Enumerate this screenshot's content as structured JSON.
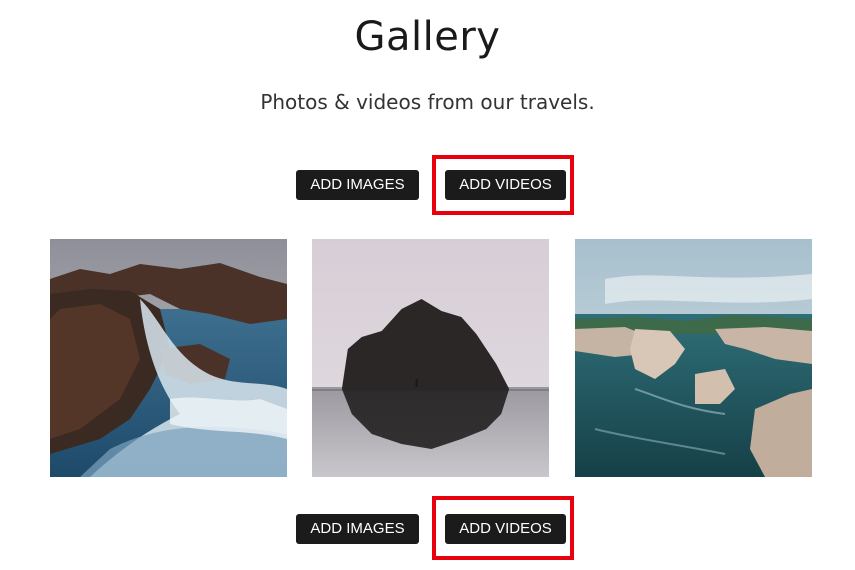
{
  "header": {
    "title": "Gallery",
    "subtitle": "Photos & videos from our travels."
  },
  "toolbar_top": {
    "add_images_label": "ADD IMAGES",
    "add_videos_label": "ADD VIDEOS"
  },
  "toolbar_bottom": {
    "add_images_label": "ADD IMAGES",
    "add_videos_label": "ADD VIDEOS"
  },
  "gallery": {
    "photos": [
      {
        "subject": "rocky-coast-waves"
      },
      {
        "subject": "sea-stack-reflection"
      },
      {
        "subject": "cliffs-teal-water"
      }
    ]
  },
  "colors": {
    "button_bg": "#1b1b1b",
    "button_text": "#ffffff",
    "highlight": "#e8000c"
  }
}
